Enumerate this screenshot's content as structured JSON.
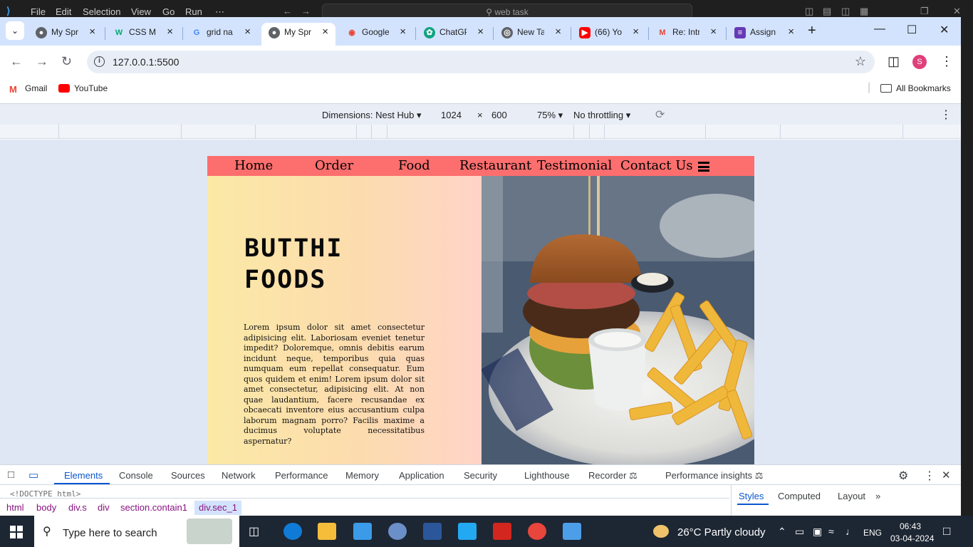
{
  "vscode": {
    "menu": [
      "File",
      "Edit",
      "Selection",
      "View",
      "Go",
      "Run",
      "⋯"
    ],
    "command_center": "web task"
  },
  "chrome": {
    "tabs": [
      {
        "title": "My Spr",
        "favicon": "globe-icon",
        "active": false
      },
      {
        "title": "CSS Ma",
        "favicon": "w3schools-icon",
        "active": false
      },
      {
        "title": "grid na",
        "favicon": "google-icon",
        "active": false
      },
      {
        "title": "My Spr",
        "favicon": "globe-icon",
        "active": true
      },
      {
        "title": "Google",
        "favicon": "google-lens-icon",
        "active": false
      },
      {
        "title": "ChatGP",
        "favicon": "chatgpt-icon",
        "active": false
      },
      {
        "title": "New Ta",
        "favicon": "chrome-icon",
        "active": false
      },
      {
        "title": "(66) Yo",
        "favicon": "youtube-icon",
        "active": false
      },
      {
        "title": "Re: Intr",
        "favicon": "gmail-icon",
        "active": false
      },
      {
        "title": "Assign",
        "favicon": "forms-icon",
        "active": false
      }
    ],
    "url": "127.0.0.1:5500",
    "profile_initial": "S",
    "bookmarks": [
      "Gmail",
      "YouTube"
    ],
    "all_bookmarks": "All Bookmarks"
  },
  "device_toolbar": {
    "dimensions_label": "Dimensions: Nest Hub",
    "width": "1024",
    "times": "×",
    "height": "600",
    "zoom": "75%",
    "throttling": "No throttling"
  },
  "site": {
    "nav": [
      "Home",
      "Order",
      "Food",
      "Restaurant",
      "Testimonial",
      "Contact Us"
    ],
    "hero_title_line1": "BUTTHI",
    "hero_title_line2": "FOODS",
    "hero_text": "Lorem ipsum dolor sit amet consectetur adipisicing elit. Laboriosam eveniet tenetur impedit? Doloremque, omnis debitis earum incidunt neque, temporibus quia quas numquam eum repellat consequatur. Eum quos quidem et enim! Lorem ipsum dolor sit amet consectetur, adipisicing elit. At non quae laudantium, facere recusandae ex obcaecati inventore eius accusantium culpa laborum magnam porro? Facilis maxime a ducimus voluptate necessitatibus aspernatur?"
  },
  "devtools": {
    "tabs": [
      "Elements",
      "Console",
      "Sources",
      "Network",
      "Performance",
      "Memory",
      "Application",
      "Security",
      "Lighthouse",
      "Recorder",
      "Performance insights"
    ],
    "dom_line": "<!DOCTYPE html>",
    "breadcrumbs": [
      "html",
      "body",
      "div.s",
      "div",
      "section.contain1",
      "div.sec_1"
    ],
    "side_tabs": [
      "Styles",
      "Computed",
      "Layout"
    ]
  },
  "taskbar": {
    "search_placeholder": "Type here to search",
    "weather": "26°C  Partly cloudy",
    "language": "ENG",
    "time": "06:43",
    "date": "03-04-2024"
  }
}
